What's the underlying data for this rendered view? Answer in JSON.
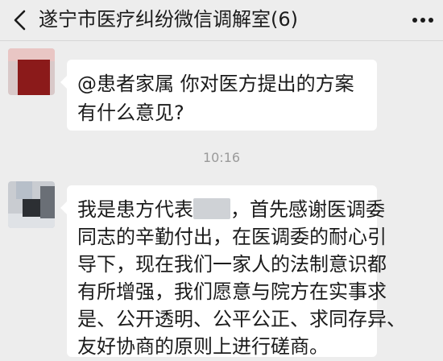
{
  "header": {
    "title": "遂宁市医疗纠纷微信调解室(6)"
  },
  "messages": [
    {
      "text": "@患者家属  你对医方提出的方案有什么意见?"
    },
    {
      "time": "10:16"
    },
    {
      "lines": [
        [
          "我是患方代表",
          "，首先感谢医调委"
        ],
        "同志的辛勤付出，在医调委的耐心引",
        "导下，现在我们一家人的法制意识都",
        "有所增强，我们愿意与院方在实事求",
        "是、公开透明、公平公正、求同存异、",
        "友好协商的原则上进行磋商。"
      ]
    }
  ]
}
